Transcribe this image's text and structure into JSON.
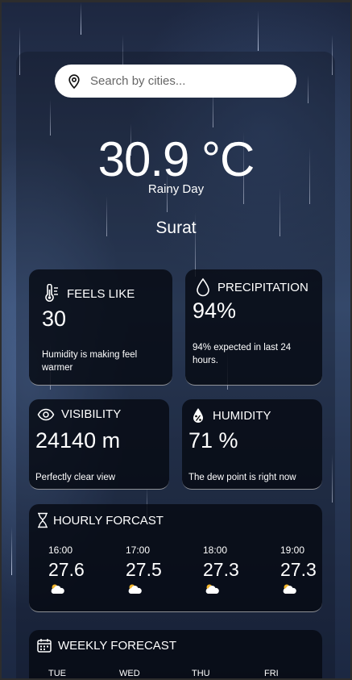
{
  "search": {
    "placeholder": "Search by cities..."
  },
  "current": {
    "temperature": "30.9 °C",
    "condition": "Rainy Day",
    "city": "Surat"
  },
  "feels_like": {
    "title": "FEELS LIKE",
    "value": "30",
    "description": "Humidity is making feel warmer",
    "icon": "thermometer-icon"
  },
  "precipitation": {
    "title": "PRECIPITATION",
    "value": "94%",
    "description": "94% expected in last 24 hours.",
    "icon": "droplet-icon"
  },
  "visibility": {
    "title": "VISIBILITY",
    "value": "24140 m",
    "description": "Perfectly clear view",
    "icon": "eye-icon"
  },
  "humidity": {
    "title": "HUMIDITY",
    "value": "71 %",
    "description": "The dew point is right now",
    "icon": "humidity-icon"
  },
  "hourly": {
    "title": "HOURLY FORCAST",
    "icon": "hourglass-icon",
    "items": [
      {
        "time": "16:00",
        "temp": "27.6",
        "icon": "partly-cloudy-icon"
      },
      {
        "time": "17:00",
        "temp": "27.5",
        "icon": "partly-cloudy-icon"
      },
      {
        "time": "18:00",
        "temp": "27.3",
        "icon": "partly-cloudy-icon"
      },
      {
        "time": "19:00",
        "temp": "27.3",
        "icon": "partly-cloudy-icon"
      }
    ]
  },
  "weekly": {
    "title": "WEEKLY FORECAST",
    "icon": "calendar-icon",
    "days": [
      "TUE",
      "WED",
      "THU",
      "FRI"
    ]
  },
  "colors": {
    "card_bg": "#080c14",
    "search_bg": "#ffffff",
    "sun": "#f2b52c"
  }
}
